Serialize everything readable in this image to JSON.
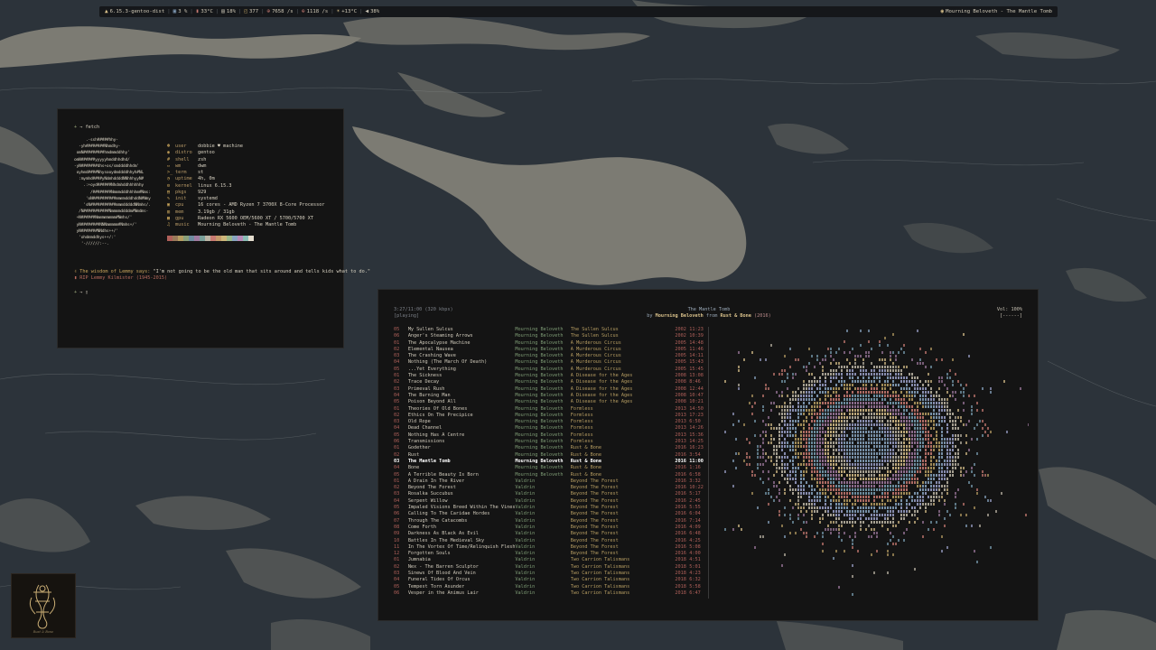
{
  "statusbar": {
    "kernel": "6.15.3-gentoo-dist",
    "cpu": "3 %",
    "cpu_temp": "33°C",
    "mem": "18%",
    "packages": "377",
    "net_down": "7658 /s",
    "net_up": "1118 /s",
    "weather": "+13°C",
    "volume": "38%",
    "now_playing": "Mourning Beloveth - The Mantle Tomb"
  },
  "fetch": {
    "prompt_top": "→ fetch",
    "ascii": [
      "     .-ssh#####hhy-",
      "  -yh########Nhmdhy-",
      " omN#########hmdmmddhhy'",
      "omN######yyyyyhmddhhdhd/",
      "-yN#######dhs+os/smddddhhdm'",
      " oyhmd####Nhysooydmddddhhyh#NL",
      "  :mymhd####yNdmhddddNNhhhyyN#",
      "    .:+oyd######Nhdmhddhhhhhhy",
      "       /########Nmmmdddhhhhm#Nms:",
      "     'oN##########mmmmdddhddN#Nmy",
      "    'sN###########mmmdddddNNmhs/.",
      "  /N###########Nmmmmddddm#Nmdms-",
      " +N######Nmmmmmmmm#Nmhs/'",
      " yN########NNNmmmmm#Nmhs+/'",
      " yN#######NNdhs++/'",
      "  'ohdmmddhys++/:'",
      "   '-//////:--."
    ],
    "info": [
      {
        "icon": "☻",
        "key": "user",
        "value": "dobbie ♥ machine"
      },
      {
        "icon": "◉",
        "key": "distro",
        "value": "gentoo"
      },
      {
        "icon": "#",
        "key": "shell",
        "value": "zsh"
      },
      {
        "icon": "▭",
        "key": "wm",
        "value": "dwm"
      },
      {
        "icon": ">_",
        "key": "term",
        "value": "st"
      },
      {
        "icon": "◔",
        "key": "uptime",
        "value": "4h, 0m"
      },
      {
        "icon": "⚙",
        "key": "kernel",
        "value": "linux 6.15.3"
      },
      {
        "icon": "▤",
        "key": "pkgs",
        "value": "929"
      },
      {
        "icon": "✎",
        "key": "init",
        "value": "systemd"
      },
      {
        "icon": "▣",
        "key": "cpu",
        "value": "16 cores - AMD Ryzen 7 3700X 8-Core Processor"
      },
      {
        "icon": "▥",
        "key": "mem",
        "value": "3.19gb / 31gb"
      },
      {
        "icon": "▩",
        "key": "gpu",
        "value": "Radeon RX 5600 OEM/5600 XT / 5700/5700 XT"
      },
      {
        "icon": "♫",
        "key": "music",
        "value": "Mourning Beloveth - The Mantle Tomb"
      }
    ],
    "palette": [
      "#b0605a",
      "#9a7a5a",
      "#b69d62",
      "#8aa07a",
      "#6f8ca0",
      "#a07aa0",
      "#7aa09a",
      "#bdb6a6",
      "#c87a72",
      "#c49a6a",
      "#cdb67a",
      "#9ab88a",
      "#88a4c0",
      "#b88ab8",
      "#8abcb4",
      "#e4ddcf"
    ],
    "quote_intro": "The wisdom of Lemmy says:",
    "quote": "\"I'm not going to be the old man that sits around and tells kids what to do.\"",
    "rip": "RIP Lemmy Kilmister (1945-2015)",
    "prompt_bottom": "→ ▯"
  },
  "player": {
    "position": "3:27/11:00 (320 kbps)",
    "state": "[playing]",
    "song_title": "The Mantle Tomb",
    "by_word": "by",
    "artist": "Mourning Beloveth",
    "from_word": "from",
    "album": "Rust & Bone",
    "year": "(2016)",
    "volume": "Vol: 100%",
    "volume_bar": "[------]",
    "tracks": [
      {
        "no": "05",
        "title": "My Sullen Sulcus",
        "artist": "Mourning Beloveth",
        "album": "The Sullen Sulcus",
        "year": "2002",
        "dur": "11:23"
      },
      {
        "no": "06",
        "title": "Anger's Steaming Arrows",
        "artist": "Mourning Beloveth",
        "album": "The Sullen Sulcus",
        "year": "2002",
        "dur": "10:39"
      },
      {
        "no": "01",
        "title": "The Apocalypse Machine",
        "artist": "Mourning Beloveth",
        "album": "A Murderous Circus",
        "year": "2005",
        "dur": "14:48"
      },
      {
        "no": "02",
        "title": "Elemental Nausea",
        "artist": "Mourning Beloveth",
        "album": "A Murderous Circus",
        "year": "2005",
        "dur": "11:46"
      },
      {
        "no": "03",
        "title": "The Crashing Wave",
        "artist": "Mourning Beloveth",
        "album": "A Murderous Circus",
        "year": "2005",
        "dur": "14:11"
      },
      {
        "no": "04",
        "title": "Nothing (The March Of Death)",
        "artist": "Mourning Beloveth",
        "album": "A Murderous Circus",
        "year": "2005",
        "dur": "15:43"
      },
      {
        "no": "05",
        "title": "...Yet Everything",
        "artist": "Mourning Beloveth",
        "album": "A Murderous Circus",
        "year": "2005",
        "dur": "15:45"
      },
      {
        "no": "01",
        "title": "The Sickness",
        "artist": "Mourning Beloveth",
        "album": "A Disease for the Ages",
        "year": "2008",
        "dur": "13:08"
      },
      {
        "no": "02",
        "title": "Trace Decay",
        "artist": "Mourning Beloveth",
        "album": "A Disease for the Ages",
        "year": "2008",
        "dur": "8:46"
      },
      {
        "no": "03",
        "title": "Primeval Rush",
        "artist": "Mourning Beloveth",
        "album": "A Disease for the Ages",
        "year": "2008",
        "dur": "12:44"
      },
      {
        "no": "04",
        "title": "The Burning Man",
        "artist": "Mourning Beloveth",
        "album": "A Disease for the Ages",
        "year": "2008",
        "dur": "10:47"
      },
      {
        "no": "05",
        "title": "Poison Beyond All",
        "artist": "Mourning Beloveth",
        "album": "A Disease for the Ages",
        "year": "2008",
        "dur": "10:21"
      },
      {
        "no": "01",
        "title": "Theories Of Old Bones",
        "artist": "Mourning Beloveth",
        "album": "Formless",
        "year": "2013",
        "dur": "14:50"
      },
      {
        "no": "02",
        "title": "Ethics On The Precipice",
        "artist": "Mourning Beloveth",
        "album": "Formless",
        "year": "2013",
        "dur": "17:23"
      },
      {
        "no": "03",
        "title": "Old Rope",
        "artist": "Mourning Beloveth",
        "album": "Formless",
        "year": "2013",
        "dur": "6:50"
      },
      {
        "no": "04",
        "title": "Dead Channel",
        "artist": "Mourning Beloveth",
        "album": "Formless",
        "year": "2013",
        "dur": "14:26"
      },
      {
        "no": "05",
        "title": "Nothing Has A Centre",
        "artist": "Mourning Beloveth",
        "album": "Formless",
        "year": "2013",
        "dur": "15:36"
      },
      {
        "no": "06",
        "title": "Transmissions",
        "artist": "Mourning Beloveth",
        "album": "Formless",
        "year": "2013",
        "dur": "14:25"
      },
      {
        "no": "01",
        "title": "Godether",
        "artist": "Mourning Beloveth",
        "album": "Rust & Bone",
        "year": "2016",
        "dur": "16:23"
      },
      {
        "no": "02",
        "title": "Rust",
        "artist": "Mourning Beloveth",
        "album": "Rust & Bone",
        "year": "2016",
        "dur": "3:54"
      },
      {
        "no": "03",
        "title": "The Mantle Tomb",
        "artist": "Mourning Beloveth",
        "album": "Rust & Bone",
        "year": "2016",
        "dur": "11:00",
        "current": true
      },
      {
        "no": "04",
        "title": "Bone",
        "artist": "Mourning Beloveth",
        "album": "Rust & Bone",
        "year": "2016",
        "dur": "1:16"
      },
      {
        "no": "05",
        "title": "A Terrible Beauty Is Born",
        "artist": "Mourning Beloveth",
        "album": "Rust & Bone",
        "year": "2016",
        "dur": "6:58"
      },
      {
        "no": "01",
        "title": "A Drain In The River",
        "artist": "Valdrin",
        "album": "Beyond The Forest",
        "year": "2016",
        "dur": "3:32"
      },
      {
        "no": "02",
        "title": "Beyond The Forest",
        "artist": "Valdrin",
        "album": "Beyond The Forest",
        "year": "2016",
        "dur": "10:22"
      },
      {
        "no": "03",
        "title": "Rosalka Succubus",
        "artist": "Valdrin",
        "album": "Beyond The Forest",
        "year": "2016",
        "dur": "5:17"
      },
      {
        "no": "04",
        "title": "Serpent Willow",
        "artist": "Valdrin",
        "album": "Beyond The Forest",
        "year": "2016",
        "dur": "2:45"
      },
      {
        "no": "05",
        "title": "Impaled Visions Breed Within The Vines",
        "artist": "Valdrin",
        "album": "Beyond The Forest",
        "year": "2016",
        "dur": "5:55"
      },
      {
        "no": "06",
        "title": "Calling To The Caridae Hordes",
        "artist": "Valdrin",
        "album": "Beyond The Forest",
        "year": "2016",
        "dur": "6:04"
      },
      {
        "no": "07",
        "title": "Through The Catacombs",
        "artist": "Valdrin",
        "album": "Beyond The Forest",
        "year": "2016",
        "dur": "7:14"
      },
      {
        "no": "08",
        "title": "Come Forth",
        "artist": "Valdrin",
        "album": "Beyond The Forest",
        "year": "2016",
        "dur": "4:09"
      },
      {
        "no": "09",
        "title": "Darkness As Black As Evil",
        "artist": "Valdrin",
        "album": "Beyond The Forest",
        "year": "2016",
        "dur": "6:48"
      },
      {
        "no": "10",
        "title": "Battles In The Medieval Sky",
        "artist": "Valdrin",
        "album": "Beyond The Forest",
        "year": "2016",
        "dur": "4:25"
      },
      {
        "no": "11",
        "title": "In The Vortex Of Time/Relinquish Flesh",
        "artist": "Valdrin",
        "album": "Beyond The Forest",
        "year": "2016",
        "dur": "5:08"
      },
      {
        "no": "12",
        "title": "Forgotten Souls",
        "artist": "Valdrin",
        "album": "Beyond The Forest",
        "year": "2016",
        "dur": "4:00"
      },
      {
        "no": "01",
        "title": "Jumnabia",
        "artist": "Valdrin",
        "album": "Two Carrion Talismans",
        "year": "2018",
        "dur": "4:51"
      },
      {
        "no": "02",
        "title": "Nex - The Barren Sculptor",
        "artist": "Valdrin",
        "album": "Two Carrion Talismans",
        "year": "2018",
        "dur": "5:01"
      },
      {
        "no": "03",
        "title": "Sinews Of Blood And Vein",
        "artist": "Valdrin",
        "album": "Two Carrion Talismans",
        "year": "2018",
        "dur": "4:23"
      },
      {
        "no": "04",
        "title": "Funeral Tides Of Orcus",
        "artist": "Valdrin",
        "album": "Two Carrion Talismans",
        "year": "2018",
        "dur": "6:32"
      },
      {
        "no": "05",
        "title": "Tempest Torn Asunder",
        "artist": "Valdrin",
        "album": "Two Carrion Talismans",
        "year": "2018",
        "dur": "5:58"
      },
      {
        "no": "06",
        "title": "Vesper in the Animus Lair",
        "artist": "Valdrin",
        "album": "Two Carrion Talismans",
        "year": "2018",
        "dur": "6:47"
      }
    ]
  },
  "album_art_caption": "Rust & Bone",
  "colors": {
    "background": "#2d343b",
    "terminal_bg": "#141414",
    "accent_gold": "#b69d62",
    "accent_red": "#b0605a",
    "accent_green": "#7f9d76"
  }
}
